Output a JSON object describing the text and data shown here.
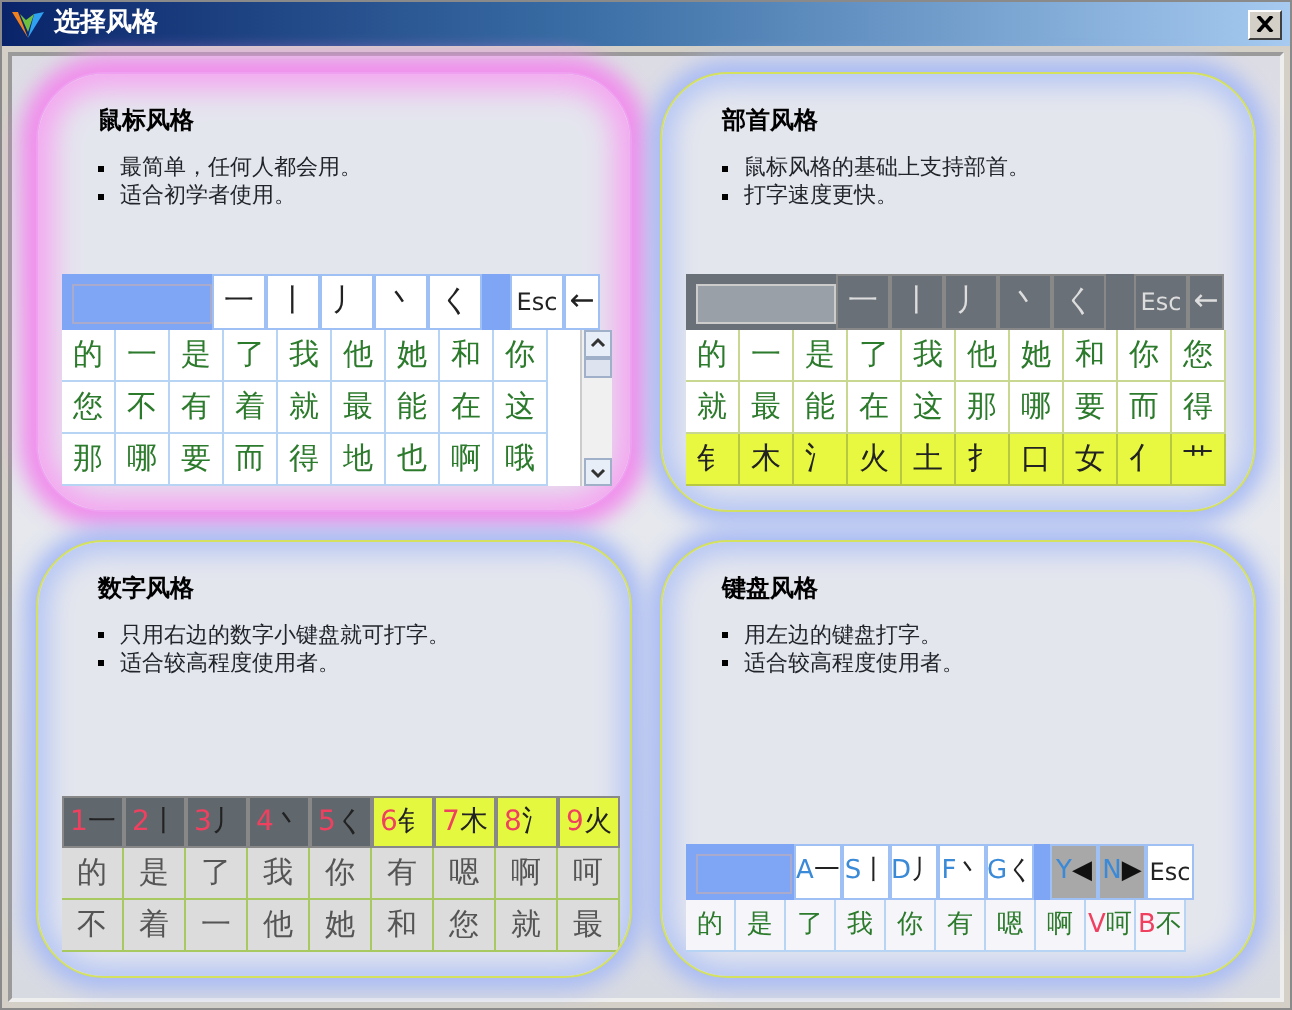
{
  "window": {
    "title": "选择风格"
  },
  "styles": [
    {
      "kind": "mouse",
      "title": "鼠标风格",
      "selected": true,
      "bullets": [
        "最简单，任何人都会用。",
        "适合初学者使用。"
      ],
      "scrollbar": true,
      "toolbar": [
        {
          "kind": "input"
        },
        {
          "kind": "stroke",
          "text": "一"
        },
        {
          "kind": "stroke",
          "text": "丨"
        },
        {
          "kind": "stroke",
          "text": "丿"
        },
        {
          "kind": "stroke",
          "text": "丶"
        },
        {
          "kind": "stroke",
          "text": "く"
        },
        {
          "kind": "gap"
        },
        {
          "kind": "esc",
          "text": "Esc"
        },
        {
          "kind": "back",
          "text": "←"
        }
      ],
      "rows": [
        {
          "kind": "chars",
          "cells": [
            {
              "text": "的"
            },
            {
              "text": "一"
            },
            {
              "text": "是"
            },
            {
              "text": "了"
            },
            {
              "text": "我"
            },
            {
              "text": "他"
            },
            {
              "text": "她"
            },
            {
              "text": "和"
            },
            {
              "text": "你"
            }
          ]
        },
        {
          "kind": "chars",
          "cells": [
            {
              "text": "您"
            },
            {
              "text": "不"
            },
            {
              "text": "有"
            },
            {
              "text": "着"
            },
            {
              "text": "就"
            },
            {
              "text": "最"
            },
            {
              "text": "能"
            },
            {
              "text": "在"
            },
            {
              "text": "这"
            }
          ]
        },
        {
          "kind": "chars",
          "cells": [
            {
              "text": "那"
            },
            {
              "text": "哪"
            },
            {
              "text": "要"
            },
            {
              "text": "而"
            },
            {
              "text": "得"
            },
            {
              "text": "地"
            },
            {
              "text": "也"
            },
            {
              "text": "啊"
            },
            {
              "text": "哦"
            }
          ]
        }
      ]
    },
    {
      "kind": "radical",
      "title": "部首风格",
      "selected": false,
      "bullets": [
        "鼠标风格的基础上支持部首。",
        "打字速度更快。"
      ],
      "toolbar": [
        {
          "kind": "input"
        },
        {
          "kind": "stroke",
          "text": "一"
        },
        {
          "kind": "stroke",
          "text": "丨"
        },
        {
          "kind": "stroke",
          "text": "丿"
        },
        {
          "kind": "stroke",
          "text": "丶"
        },
        {
          "kind": "stroke",
          "text": "く"
        },
        {
          "kind": "gap"
        },
        {
          "kind": "esc",
          "text": "Esc"
        },
        {
          "kind": "back",
          "text": "←"
        }
      ],
      "rows": [
        {
          "kind": "chars",
          "cells": [
            {
              "text": "的"
            },
            {
              "text": "一"
            },
            {
              "text": "是"
            },
            {
              "text": "了"
            },
            {
              "text": "我"
            },
            {
              "text": "他"
            },
            {
              "text": "她"
            },
            {
              "text": "和"
            },
            {
              "text": "你"
            },
            {
              "text": "您"
            }
          ]
        },
        {
          "kind": "chars",
          "cells": [
            {
              "text": "就"
            },
            {
              "text": "最"
            },
            {
              "text": "能"
            },
            {
              "text": "在"
            },
            {
              "text": "这"
            },
            {
              "text": "那"
            },
            {
              "text": "哪"
            },
            {
              "text": "要"
            },
            {
              "text": "而"
            },
            {
              "text": "得"
            }
          ]
        },
        {
          "kind": "radicals",
          "cells": [
            {
              "text": "钅"
            },
            {
              "text": "木"
            },
            {
              "text": "氵"
            },
            {
              "text": "火"
            },
            {
              "text": "土"
            },
            {
              "text": "扌"
            },
            {
              "text": "口"
            },
            {
              "text": "女"
            },
            {
              "text": "亻"
            },
            {
              "text": "艹"
            }
          ]
        }
      ]
    },
    {
      "kind": "number",
      "title": "数字风格",
      "selected": false,
      "bullets": [
        "只用右边的数字小键盘就可打字。",
        "适合较高程度使用者。"
      ],
      "rows": [
        {
          "kind": "numkeys",
          "cells": [
            {
              "kind": "stroke",
              "key": "1",
              "text": "一"
            },
            {
              "kind": "stroke",
              "key": "2",
              "text": "丨"
            },
            {
              "kind": "stroke",
              "key": "3",
              "text": "丿"
            },
            {
              "kind": "stroke",
              "key": "4",
              "text": "丶"
            },
            {
              "kind": "stroke",
              "key": "5",
              "text": "く"
            },
            {
              "kind": "radical",
              "key": "6",
              "text": "钅"
            },
            {
              "kind": "radical",
              "key": "7",
              "text": "木"
            },
            {
              "kind": "radical",
              "key": "8",
              "text": "氵"
            },
            {
              "kind": "radical",
              "key": "9",
              "text": "火"
            }
          ]
        },
        {
          "kind": "grey",
          "cells": [
            {
              "text": "的"
            },
            {
              "text": "是"
            },
            {
              "text": "了"
            },
            {
              "text": "我"
            },
            {
              "text": "你"
            },
            {
              "text": "有"
            },
            {
              "text": "嗯"
            },
            {
              "text": "啊"
            },
            {
              "text": "呵"
            }
          ]
        },
        {
          "kind": "grey",
          "cells": [
            {
              "text": "不"
            },
            {
              "text": "着"
            },
            {
              "text": "一"
            },
            {
              "text": "他"
            },
            {
              "text": "她"
            },
            {
              "text": "和"
            },
            {
              "text": "您"
            },
            {
              "text": "就"
            },
            {
              "text": "最"
            }
          ]
        }
      ]
    },
    {
      "kind": "keyboard",
      "title": "键盘风格",
      "selected": false,
      "bullets": [
        "用左边的键盘打字。",
        "适合较高程度使用者。"
      ],
      "toolbar": [
        {
          "kind": "input"
        },
        {
          "kind": "stroke",
          "key": "A",
          "text": "一"
        },
        {
          "kind": "stroke",
          "key": "S",
          "text": "丨"
        },
        {
          "kind": "stroke",
          "key": "D",
          "text": "丿"
        },
        {
          "kind": "stroke",
          "key": "F",
          "text": "丶"
        },
        {
          "kind": "stroke",
          "key": "G",
          "text": "く"
        },
        {
          "kind": "gap"
        },
        {
          "kind": "nav",
          "key": "Y",
          "text": "◀"
        },
        {
          "kind": "nav",
          "key": "N",
          "text": "▶"
        },
        {
          "kind": "esc",
          "text": "Esc"
        }
      ],
      "rows": [
        {
          "kind": "keychars",
          "cells": [
            {
              "text": "的"
            },
            {
              "text": "是"
            },
            {
              "text": "了"
            },
            {
              "text": "我"
            },
            {
              "text": "你"
            },
            {
              "text": "有"
            },
            {
              "text": "嗯"
            },
            {
              "text": "啊"
            },
            {
              "key": "V",
              "text": "呵"
            },
            {
              "key": "B",
              "text": "不"
            }
          ]
        }
      ]
    }
  ]
}
